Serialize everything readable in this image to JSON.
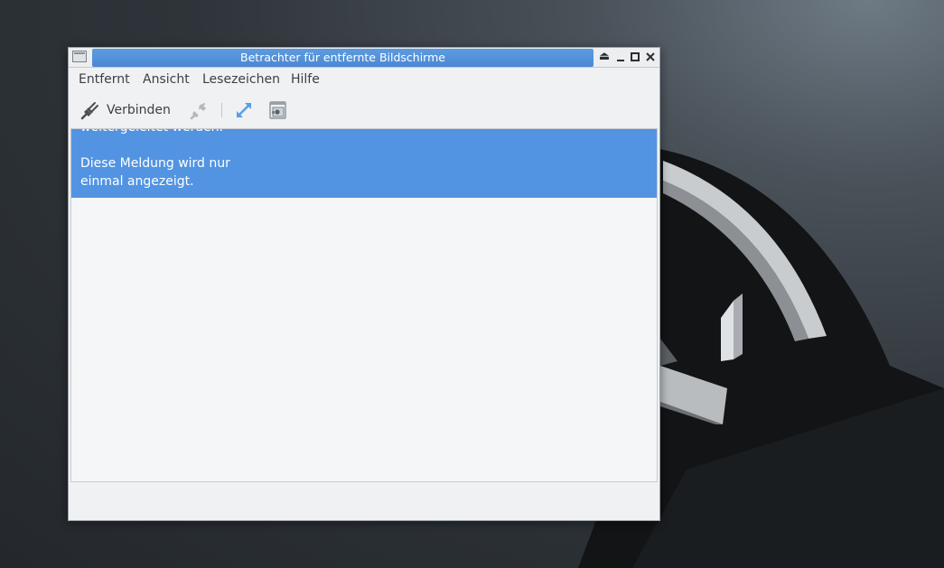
{
  "window": {
    "title": "Betrachter für entfernte Bildschirme"
  },
  "menu": {
    "items": [
      "Entfernt",
      "Ansicht",
      "Lesezeichen",
      "Hilfe"
    ]
  },
  "toolbar": {
    "connect_label": "Verbinden",
    "icons": [
      "connect-plug-icon",
      "disconnect-plug-icon",
      "fullscreen-icon",
      "screenshot-icon"
    ]
  },
  "banner": {
    "line_partial": "weitergeleitet werden.",
    "line1": "Diese Meldung wird nur",
    "line2": "einmal angezeigt."
  },
  "colors": {
    "accent": "#5294e2",
    "title_active": "#4a88d4",
    "window_bg": "#f0f1f3",
    "content_bg": "#f5f6f8"
  }
}
